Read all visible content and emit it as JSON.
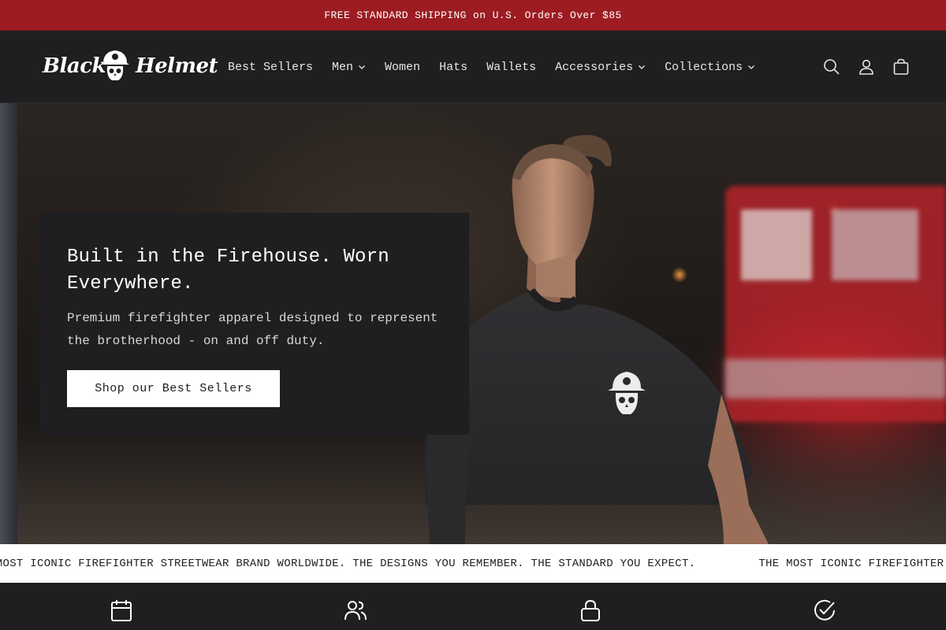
{
  "announcement": {
    "text": "FREE STANDARD SHIPPING on U.S. Orders Over $85"
  },
  "brand": {
    "name": "Black Helmet",
    "word1": "Black",
    "word2": "Helmet"
  },
  "nav": {
    "items": [
      {
        "label": "Best Sellers",
        "dropdown": false
      },
      {
        "label": "Men",
        "dropdown": true
      },
      {
        "label": "Women",
        "dropdown": false
      },
      {
        "label": "Hats",
        "dropdown": false
      },
      {
        "label": "Wallets",
        "dropdown": false
      },
      {
        "label": "Accessories",
        "dropdown": true
      },
      {
        "label": "Collections",
        "dropdown": true
      }
    ]
  },
  "header_icons": [
    "search-icon",
    "account-icon",
    "cart-icon"
  ],
  "hero": {
    "title": "Built in the Firehouse. Worn Everywhere.",
    "subtitle": "Premium firefighter apparel designed to represent the brotherhood - on and off duty.",
    "cta_label": "Shop our Best Sellers"
  },
  "marquee": {
    "text": "THE MOST ICONIC FIREFIGHTER STREETWEAR BRAND WORLDWIDE. THE DESIGNS YOU REMEMBER. THE STANDARD YOU EXPECT."
  },
  "features": {
    "icons": [
      "calendar-icon",
      "users-icon",
      "lock-icon",
      "check-circle-icon"
    ]
  },
  "colors": {
    "announcement_bg": "#9c1c22",
    "header_bg": "#1f1f21",
    "button_bg": "#ffffff"
  }
}
